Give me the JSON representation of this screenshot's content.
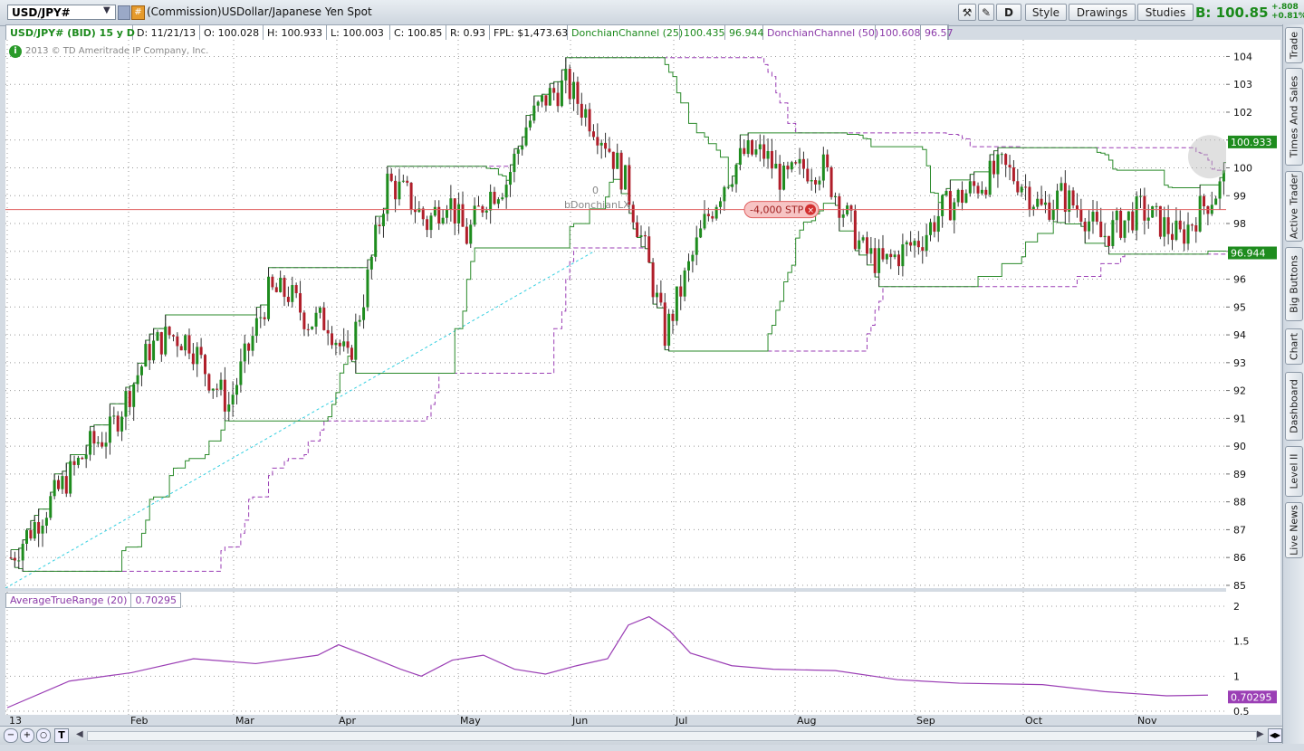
{
  "toolbar": {
    "symbol": "USD/JPY#",
    "description": "(Commission)USDollar/Japanese Yen Spot",
    "period_button": "D",
    "style_label": "Style",
    "drawings_label": "Drawings",
    "studies_label": "Studies",
    "bid": "B: 100.85",
    "change_abs": "+.808",
    "change_pct": "+0.81%"
  },
  "infobar": {
    "title": "USD/JPY# (BID) 15 y D",
    "date": "D: 11/21/13",
    "open": "O: 100.028",
    "high": "H: 100.933",
    "low": "L: 100.003",
    "close": "C: 100.85",
    "range": "R: 0.93",
    "fpl": "FPL: $1,473.63",
    "dc25_label": "DonchianChannel (25)",
    "dc25_upper": "100.435",
    "dc25_lower": "96.944",
    "dc50_label": "DonchianChannel (50)",
    "dc50_upper": "100.608",
    "dc50_lower": "96.57"
  },
  "copyright": "2013 © TD Ameritrade IP Company, Inc.",
  "order_label": "-4,000 STP",
  "strategy_label": "bDonchianLX",
  "strategy_qty": "0",
  "atr": {
    "label": "AverageTrueRange (20)",
    "value": "0.70295"
  },
  "side_tabs": [
    "Trade",
    "Times And Sales",
    "Active Trader",
    "Big Buttons",
    "Chart",
    "Dashboard",
    "Level II",
    "Live News"
  ],
  "colors": {
    "up": "#1e8c1e",
    "down": "#b01e2a",
    "dc25": "#2a8a2a",
    "dc50": "#9b3fb5",
    "atr": "#9b3fb5",
    "order": "#e06060",
    "trendline": "#33cfe0"
  },
  "chart_data": {
    "type": "candlestick",
    "y_range": [
      84.9,
      104.6
    ],
    "y_ticks": [
      85,
      86,
      87,
      88,
      89,
      90,
      91,
      92,
      93,
      94,
      95,
      96,
      97,
      98,
      99,
      100,
      101,
      102,
      103,
      104
    ],
    "x_labels": [
      "13",
      "Feb",
      "Mar",
      "Apr",
      "May",
      "Jun",
      "Jul",
      "Aug",
      "Sep",
      "Oct",
      "Nov"
    ],
    "price_tags": {
      "high": "100.933",
      "dc25_lower": "96.944",
      "atr": "0.70295"
    },
    "order_level": 98.5,
    "close_path": [
      [
        0,
        86.0
      ],
      [
        10,
        88.0
      ],
      [
        20,
        90.0
      ],
      [
        25,
        90.5
      ],
      [
        30,
        92.0
      ],
      [
        35,
        93.5
      ],
      [
        40,
        94.0
      ],
      [
        45,
        93.8
      ],
      [
        50,
        92.5
      ],
      [
        55,
        91.5
      ],
      [
        60,
        93.5
      ],
      [
        65,
        95.5
      ],
      [
        70,
        95.5
      ],
      [
        75,
        94.5
      ],
      [
        80,
        94.5
      ],
      [
        85,
        93.0
      ],
      [
        90,
        96.0
      ],
      [
        95,
        99.5
      ],
      [
        100,
        99.0
      ],
      [
        105,
        98.0
      ],
      [
        110,
        99.0
      ],
      [
        115,
        97.5
      ],
      [
        120,
        99.0
      ],
      [
        125,
        99.5
      ],
      [
        130,
        101.5
      ],
      [
        135,
        102.5
      ],
      [
        140,
        103.0
      ],
      [
        145,
        102.0
      ],
      [
        150,
        101.0
      ],
      [
        155,
        99.5
      ],
      [
        160,
        97.0
      ],
      [
        165,
        94.0
      ],
      [
        170,
        96.0
      ],
      [
        175,
        98.0
      ],
      [
        180,
        99.5
      ],
      [
        185,
        100.5
      ],
      [
        190,
        100.5
      ],
      [
        195,
        99.5
      ],
      [
        200,
        100.0
      ],
      [
        205,
        100.0
      ],
      [
        210,
        98.5
      ],
      [
        215,
        97.0
      ],
      [
        220,
        96.5
      ],
      [
        225,
        97.0
      ],
      [
        230,
        97.5
      ],
      [
        235,
        98.5
      ],
      [
        240,
        99.0
      ],
      [
        245,
        99.5
      ],
      [
        250,
        100.0
      ],
      [
        255,
        99.5
      ],
      [
        260,
        98.5
      ],
      [
        265,
        99.0
      ],
      [
        270,
        98.5
      ],
      [
        275,
        97.5
      ],
      [
        280,
        98.0
      ],
      [
        285,
        98.5
      ],
      [
        290,
        98.0
      ],
      [
        295,
        97.5
      ],
      [
        300,
        98.5
      ],
      [
        305,
        99.3
      ],
      [
        310,
        100.5
      ],
      [
        316,
        100.85
      ]
    ],
    "atr_path": [
      [
        0,
        0.55
      ],
      [
        30,
        0.9
      ],
      [
        60,
        1.05
      ],
      [
        90,
        1.25
      ],
      [
        120,
        1.15
      ],
      [
        150,
        1.3
      ],
      [
        160,
        1.45
      ],
      [
        175,
        1.25
      ],
      [
        190,
        1.1
      ],
      [
        200,
        1.0
      ],
      [
        215,
        1.2
      ],
      [
        230,
        1.3
      ],
      [
        245,
        1.1
      ],
      [
        260,
        1.0
      ],
      [
        275,
        1.15
      ],
      [
        290,
        1.25
      ],
      [
        300,
        1.7
      ],
      [
        310,
        1.85
      ],
      [
        320,
        1.65
      ],
      [
        330,
        1.3
      ],
      [
        350,
        1.15
      ],
      [
        370,
        1.1
      ],
      [
        400,
        1.05
      ],
      [
        430,
        0.95
      ],
      [
        460,
        0.9
      ],
      [
        500,
        0.85
      ],
      [
        530,
        0.78
      ],
      [
        560,
        0.72
      ],
      [
        580,
        0.7
      ]
    ],
    "atr_range": [
      0.5,
      2.0
    ],
    "atr_ticks": [
      0.5,
      1,
      1.5,
      2
    ]
  }
}
